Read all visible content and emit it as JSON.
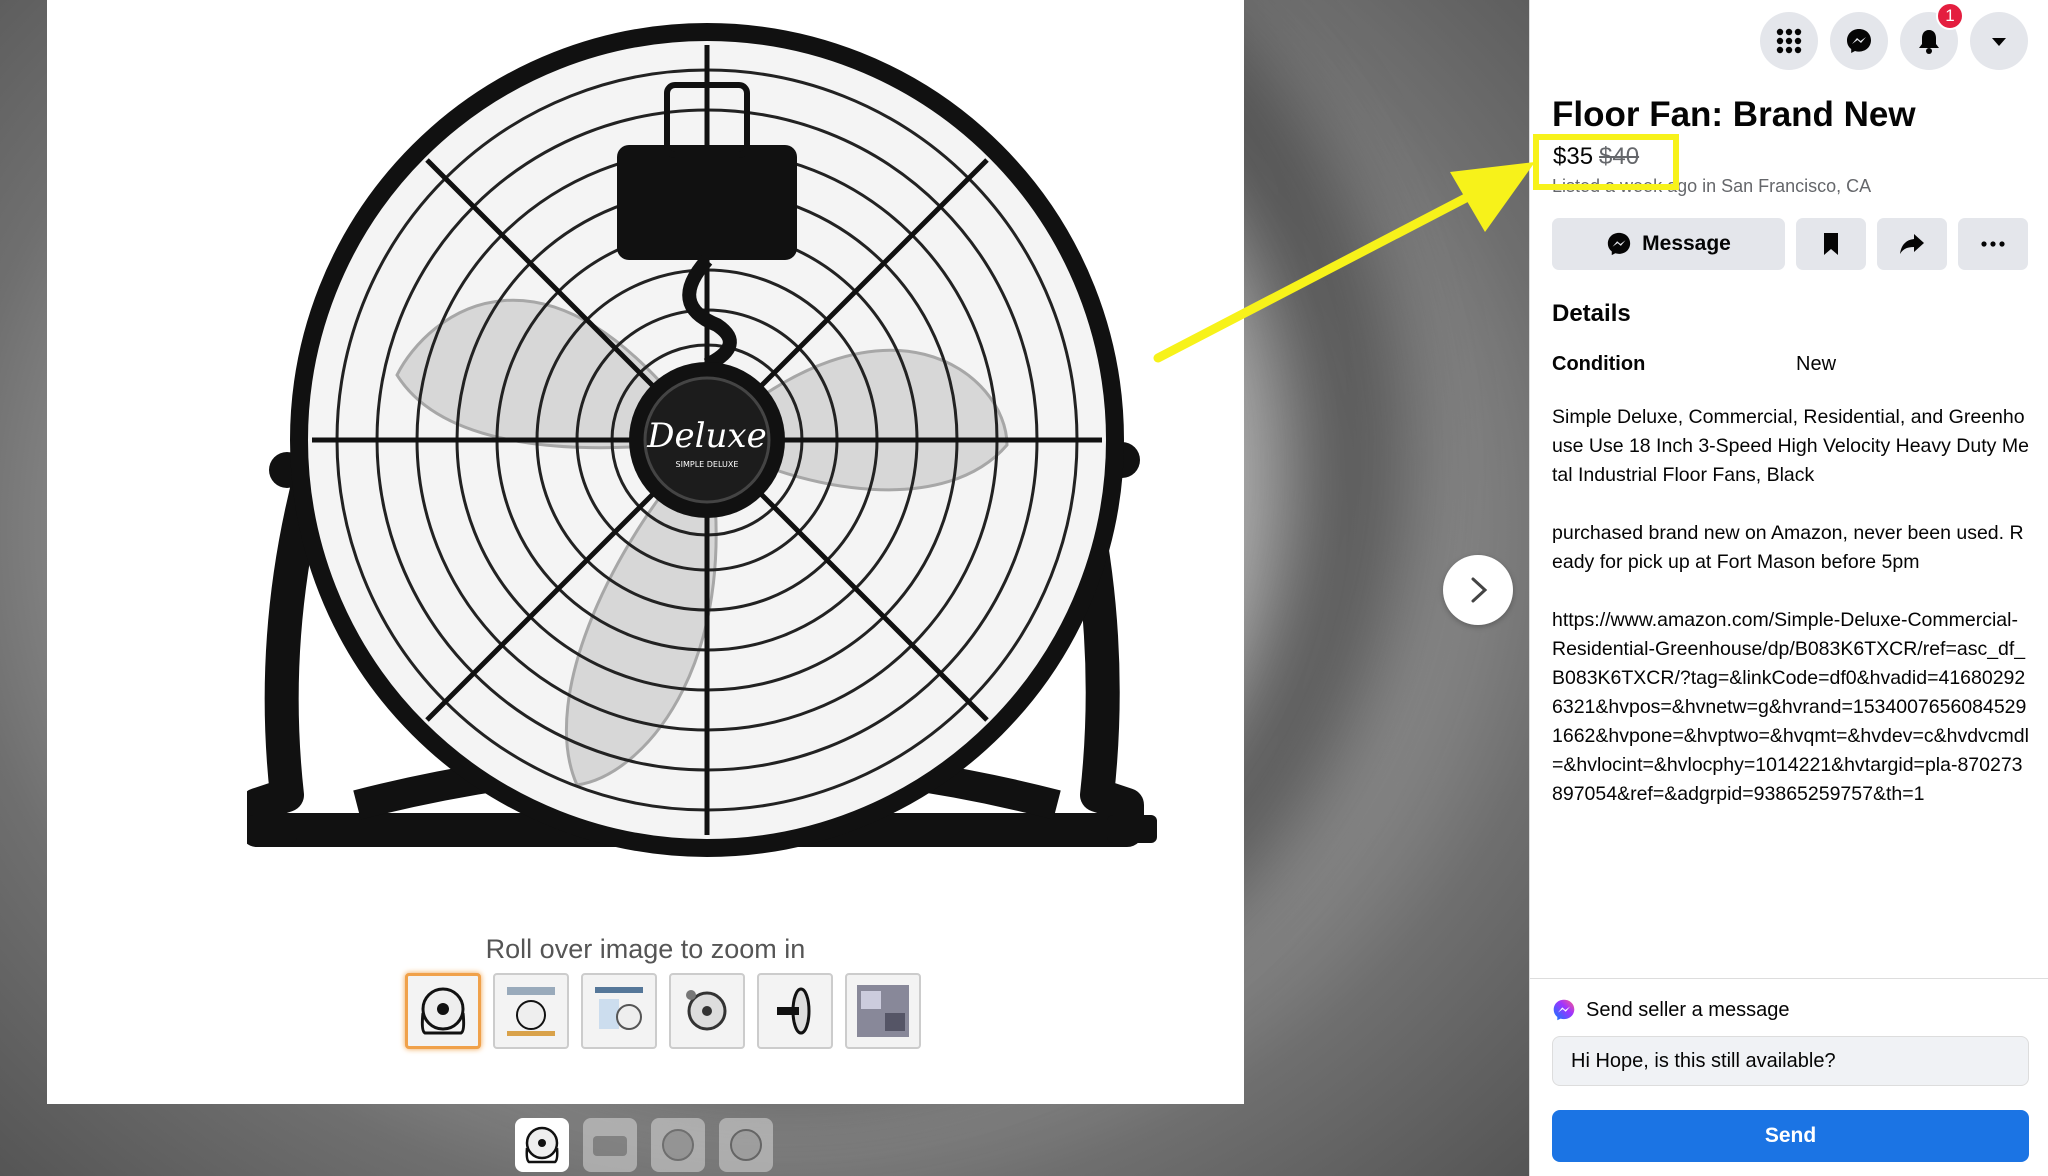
{
  "viewer": {
    "zoom_hint": "Roll over image to zoom in",
    "brand_logo": "Deluxe",
    "brand_subtext": "SIMPLE DELUXE",
    "thumbnails": [
      "thumb-1",
      "thumb-2",
      "thumb-3",
      "thumb-4",
      "thumb-5",
      "thumb-6"
    ],
    "bottom_thumbnails": [
      "photo-1",
      "photo-2",
      "photo-3",
      "photo-4"
    ]
  },
  "header": {
    "icons": [
      "menu-grid-icon",
      "messenger-icon",
      "bell-icon",
      "caret-down-icon"
    ],
    "notification_count": "1"
  },
  "listing": {
    "title": "Floor Fan: Brand New",
    "price": "$35",
    "old_price": "$40",
    "listed": "Listed a week ago in San Francisco, CA",
    "message_label": "Message",
    "details_heading": "Details",
    "condition_label": "Condition",
    "condition_value": "New",
    "description": "Simple Deluxe, Commercial, Residential, and Greenhouse Use 18 Inch 3-Speed High Velocity Heavy Duty Metal Industrial Floor Fans, Black\n\npurchased brand new on Amazon, never been used. Ready for pick up at Fort Mason before 5pm\n\nhttps://www.amazon.com/Simple-Deluxe-Commercial-Residential-Greenhouse/dp/B083K6TXCR/ref=asc_df_B083K6TXCR/?tag=&linkCode=df0&hvadid=416802926321&hvpos=&hvnetw=g&hvrand=15340076560845291662&hvpone=&hvptwo=&hvqmt=&hvdev=c&hvdvcmdl=&hvlocint=&hvlocphy=1014221&hvtargid=pla-870273897054&ref=&adgrpid=93865259757&th=1"
  },
  "seller": {
    "prompt": "Send seller a message",
    "message_value": "Hi Hope, is this still available?",
    "send_label": "Send"
  },
  "colors": {
    "highlight": "#f7f21a",
    "send_button": "#1b74e4",
    "badge": "#e41e3f"
  }
}
